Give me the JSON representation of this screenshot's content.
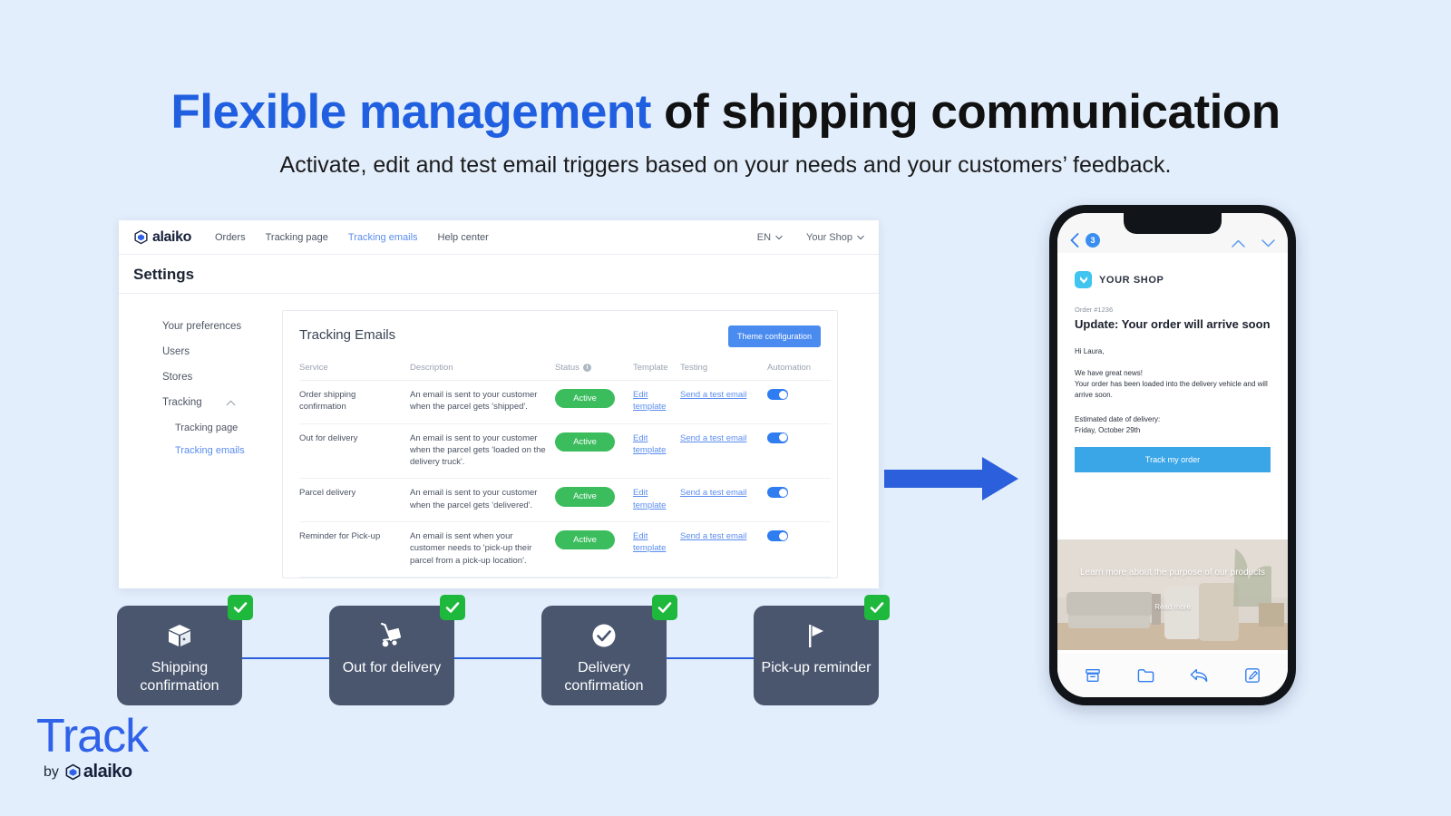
{
  "headline": {
    "accent": "Flexible management",
    "rest": " of shipping communication",
    "subtitle": "Activate, edit and test email triggers based on your needs and your customers’ feedback."
  },
  "colors": {
    "page_bg": "#e3eefc",
    "accent_blue": "#1f5fe0",
    "link_blue": "#5b8def",
    "active_green": "#3bbd5e",
    "check_green": "#1eb83c",
    "step_card": "#49566e",
    "toggle_on": "#2f7df0"
  },
  "dashboard": {
    "brand": "alaiko",
    "nav": [
      {
        "label": "Orders",
        "active": false
      },
      {
        "label": "Tracking page",
        "active": false
      },
      {
        "label": "Tracking emails",
        "active": true
      },
      {
        "label": "Help center",
        "active": false
      }
    ],
    "nav_right": [
      {
        "label": "EN"
      },
      {
        "label": "Your Shop"
      }
    ],
    "page_title": "Settings",
    "sidebar": [
      {
        "label": "Your preferences",
        "sub": false,
        "current": false,
        "chevron": false
      },
      {
        "label": "Users",
        "sub": false,
        "current": false,
        "chevron": false
      },
      {
        "label": "Stores",
        "sub": false,
        "current": false,
        "chevron": false
      },
      {
        "label": "Tracking",
        "sub": false,
        "current": false,
        "chevron": true
      },
      {
        "label": "Tracking page",
        "sub": true,
        "current": false,
        "chevron": false
      },
      {
        "label": "Tracking emails",
        "sub": true,
        "current": true,
        "chevron": false
      }
    ],
    "panel": {
      "title": "Tracking Emails",
      "theme_button": "Theme configuration",
      "columns": [
        "Service",
        "Description",
        "Status",
        "Template",
        "Testing",
        "Automation"
      ],
      "rows": [
        {
          "service": "Order shipping confirmation",
          "description": "An email is sent to your customer when the parcel gets 'shipped'.",
          "status": "Active",
          "template": "Edit template",
          "testing": "Send a test email",
          "automation_on": true
        },
        {
          "service": "Out for delivery",
          "description": "An email is sent to your customer when the parcel gets 'loaded on the delivery truck'.",
          "status": "Active",
          "template": "Edit template",
          "testing": "Send a test email",
          "automation_on": true
        },
        {
          "service": "Parcel delivery",
          "description": "An email is sent to your customer when the parcel gets 'delivered'.",
          "status": "Active",
          "template": "Edit template",
          "testing": "Send a test email",
          "automation_on": true
        },
        {
          "service": "Reminder for Pick-up",
          "description": "An email is sent when your customer needs to 'pick-up their parcel from a pick-up location'.",
          "status": "Active",
          "template": "Edit template",
          "testing": "Send a test email",
          "automation_on": true
        }
      ]
    }
  },
  "phone": {
    "mail_header": {
      "unread_count": "3"
    },
    "shop_name": "YOUR SHOP",
    "order_number": "Order #1236",
    "title": "Update: Your order will arrive soon",
    "greeting": "Hi Laura,",
    "paragraph": "We have great news!\nYour order has been loaded into the delivery vehicle and will arrive soon.",
    "eta": "Estimated date of delivery:\nFriday, October 29th",
    "cta": "Track my order",
    "promo_caption": "Learn more about the purpose of our products",
    "promo_link": "Read more"
  },
  "steps": [
    {
      "label": "Shipping confirmation",
      "icon": "package-icon",
      "checked": true
    },
    {
      "label": "Out for delivery",
      "icon": "hand-truck-icon",
      "checked": true
    },
    {
      "label": "Delivery confirmation",
      "icon": "check-circle-icon",
      "checked": true
    },
    {
      "label": "Pick-up reminder",
      "icon": "flag-icon",
      "checked": true
    }
  ],
  "footer_logo": {
    "product": "Track",
    "by": "by",
    "company": "alaiko"
  }
}
